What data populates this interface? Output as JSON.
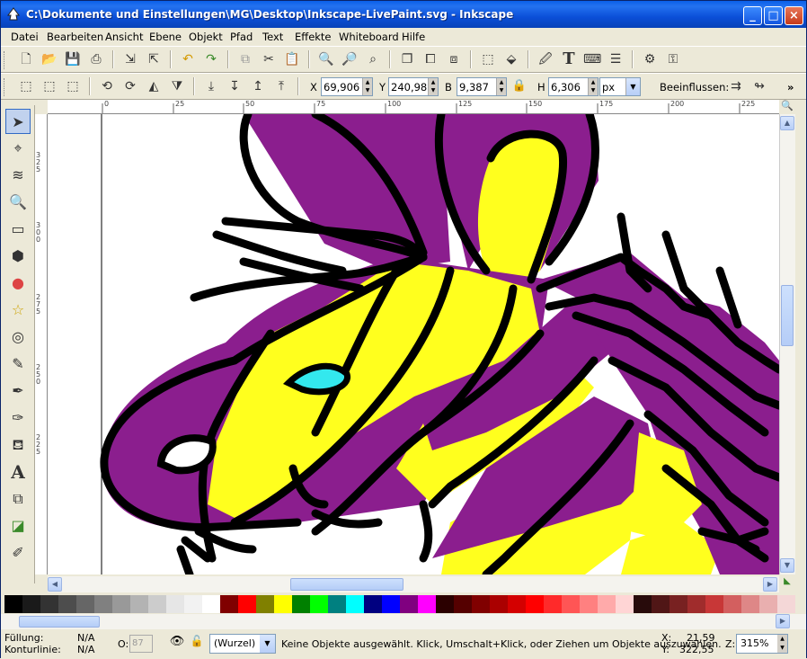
{
  "window": {
    "title": "C:\\Dokumente und Einstellungen\\MG\\Desktop\\Inkscape-LivePaint.svg - Inkscape",
    "minimize": "_",
    "maximize": "□",
    "close": "×"
  },
  "menu": [
    "Datei",
    "Bearbeiten",
    "Ansicht",
    "Ebene",
    "Objekt",
    "Pfad",
    "Text",
    "Effekte",
    "Whiteboard",
    "Hilfe"
  ],
  "toolbar_controls": {
    "x_label": "X",
    "x_value": "69,906",
    "y_label": "Y",
    "y_value": "240,986",
    "b_label": "B",
    "b_value": "9,387",
    "h_label": "H",
    "h_value": "6,306",
    "unit": "px",
    "affect_label": "Beeinflussen:",
    "more": "»"
  },
  "ruler": {
    "h_ticks": [
      "0",
      "25",
      "50",
      "75",
      "100",
      "125",
      "150",
      "175",
      "200",
      "225"
    ],
    "v_ticks": [
      "325",
      "300",
      "275",
      "250",
      "225"
    ]
  },
  "palette": {
    "colors": [
      "#000000",
      "#1a1a1a",
      "#333333",
      "#4d4d4d",
      "#666666",
      "#808080",
      "#999999",
      "#b3b3b3",
      "#cccccc",
      "#e6e6e6",
      "#f2f2f2",
      "#ffffff",
      "#800000",
      "#ff0000",
      "#808000",
      "#ffff00",
      "#008000",
      "#00ff00",
      "#008080",
      "#00ffff",
      "#000080",
      "#0000ff",
      "#800080",
      "#ff00ff",
      "#2b0000",
      "#550000",
      "#800000",
      "#aa0000",
      "#d40000",
      "#ff0000",
      "#ff2a2a",
      "#ff5555",
      "#ff8080",
      "#ffaaaa",
      "#ffd5d5",
      "#280b0b",
      "#501616",
      "#782121",
      "#a02c2c",
      "#c83737",
      "#d35f5f",
      "#de8787",
      "#e9afaf",
      "#f4d7d7"
    ]
  },
  "status": {
    "fill_label": "Füllung:",
    "fill_value": "N/A",
    "stroke_label": "Konturlinie:",
    "stroke_value": "N/A",
    "opacity_label": "O:",
    "opacity_value": "87",
    "layer": "(Wurzel)",
    "message": "Keine Objekte ausgewählt. Klick, Umschalt+Klick, oder Ziehen um Objekte auszuwählen.",
    "coord_x_label": "X:",
    "coord_x": "21,59",
    "coord_y_label": "Y:",
    "coord_y": "322,55",
    "zoom_label": "Z:",
    "zoom": "315%"
  },
  "colors": {
    "purple": "#8B1E8E",
    "yellow": "#FFFF1E",
    "cyan": "#33E8EE",
    "titlebar": "#0A5FE8"
  }
}
